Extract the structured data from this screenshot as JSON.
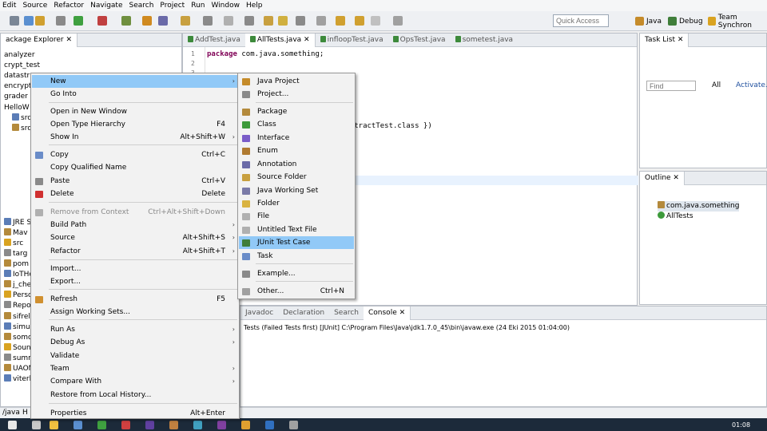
{
  "menubar": [
    "Edit",
    "Source",
    "Refactor",
    "Navigate",
    "Search",
    "Project",
    "Run",
    "Window",
    "Help"
  ],
  "quick_access": "Quick Access",
  "perspectives": {
    "java": "Java",
    "debug": "Debug",
    "team": "Team Synchron"
  },
  "package_explorer": {
    "tab": "ackage Explorer",
    "items": [
      "analyzer",
      "crypt_test",
      "datastr",
      "encrypt",
      "grader",
      "HelloW",
      "src/",
      "src/",
      "",
      "",
      "",
      "",
      "",
      "",
      "",
      "",
      "JRE S",
      "Mav",
      "src",
      "targ",
      "pom",
      "IoTHom",
      "j_checke",
      "Person",
      "Reporte",
      "sifrelem",
      "simulat",
      "somcmi",
      "SoundG",
      "summar",
      "UAON",
      "viterbi"
    ]
  },
  "editor": {
    "tabs": [
      "AddTest.java",
      "AllTests.java",
      "infloopTest.java",
      "OpsTest.java",
      "sometest.java"
    ],
    "lines": [
      {
        "n": "1",
        "pre": "",
        "kw": "package",
        "rest": " com.java.something;"
      },
      {
        "n": "2",
        "pre": "",
        "kw": "",
        "rest": ""
      },
      {
        "n": "3",
        "pre": "",
        "kw": "",
        "rest": ""
      },
      {
        "n": "",
        "pre": "",
        "kw": "",
        "rest": "                        Classes;"
      },
      {
        "n": "",
        "pre": "",
        "kw": "",
        "rest": "                      t.class, SubtractTest.class })"
      }
    ]
  },
  "task_list": {
    "tab": "Task List",
    "find_placeholder": "Find",
    "all": "All",
    "activate": "Activate..."
  },
  "outline": {
    "tab": "Outline",
    "items": [
      "com.java.something",
      "AllTests"
    ]
  },
  "console": {
    "tabs": [
      "Javadoc",
      "Declaration",
      "Search",
      "Console"
    ],
    "text": "Tests (Failed Tests first) [JUnit] C:\\Program Files\\Java\\jdk1.7.0_45\\bin\\javaw.exe (24 Eki 2015 01:04:00)"
  },
  "status": {
    "left": "/java",
    "mid": "H"
  },
  "taskbar": {
    "time": "01:08"
  },
  "context_menu": [
    {
      "label": "New",
      "shortcut": "",
      "sub": true,
      "hl": true
    },
    {
      "label": "Go Into",
      "shortcut": "",
      "sub": false
    },
    {
      "label": "Open in New Window",
      "shortcut": "",
      "sub": false
    },
    {
      "label": "Open Type Hierarchy",
      "shortcut": "F4",
      "sub": false
    },
    {
      "label": "Show In",
      "shortcut": "Alt+Shift+W",
      "sub": true
    },
    {
      "label": "Copy",
      "shortcut": "Ctrl+C",
      "sub": false
    },
    {
      "label": "Copy Qualified Name",
      "shortcut": "",
      "sub": false
    },
    {
      "label": "Paste",
      "shortcut": "Ctrl+V",
      "sub": false
    },
    {
      "label": "Delete",
      "shortcut": "Delete",
      "sub": false
    },
    {
      "label": "Remove from Context",
      "shortcut": "Ctrl+Alt+Shift+Down",
      "sub": false,
      "dis": true
    },
    {
      "label": "Build Path",
      "shortcut": "",
      "sub": true
    },
    {
      "label": "Source",
      "shortcut": "Alt+Shift+S",
      "sub": true
    },
    {
      "label": "Refactor",
      "shortcut": "Alt+Shift+T",
      "sub": true
    },
    {
      "label": "Import...",
      "shortcut": "",
      "sub": false
    },
    {
      "label": "Export...",
      "shortcut": "",
      "sub": false
    },
    {
      "label": "Refresh",
      "shortcut": "F5",
      "sub": false
    },
    {
      "label": "Assign Working Sets...",
      "shortcut": "",
      "sub": false
    },
    {
      "label": "Run As",
      "shortcut": "",
      "sub": true
    },
    {
      "label": "Debug As",
      "shortcut": "",
      "sub": true
    },
    {
      "label": "Validate",
      "shortcut": "",
      "sub": false
    },
    {
      "label": "Team",
      "shortcut": "",
      "sub": true
    },
    {
      "label": "Compare With",
      "shortcut": "",
      "sub": true
    },
    {
      "label": "Restore from Local History...",
      "shortcut": "",
      "sub": false
    },
    {
      "label": "Properties",
      "shortcut": "Alt+Enter",
      "sub": false
    }
  ],
  "new_submenu": [
    {
      "label": "Java Project",
      "shortcut": ""
    },
    {
      "label": "Project...",
      "shortcut": ""
    },
    {
      "label": "Package",
      "shortcut": ""
    },
    {
      "label": "Class",
      "shortcut": ""
    },
    {
      "label": "Interface",
      "shortcut": ""
    },
    {
      "label": "Enum",
      "shortcut": ""
    },
    {
      "label": "Annotation",
      "shortcut": ""
    },
    {
      "label": "Source Folder",
      "shortcut": ""
    },
    {
      "label": "Java Working Set",
      "shortcut": ""
    },
    {
      "label": "Folder",
      "shortcut": ""
    },
    {
      "label": "File",
      "shortcut": ""
    },
    {
      "label": "Untitled Text File",
      "shortcut": ""
    },
    {
      "label": "JUnit Test Case",
      "shortcut": "",
      "hl": true
    },
    {
      "label": "Task",
      "shortcut": ""
    },
    {
      "label": "Example...",
      "shortcut": ""
    },
    {
      "label": "Other...",
      "shortcut": "Ctrl+N"
    }
  ]
}
